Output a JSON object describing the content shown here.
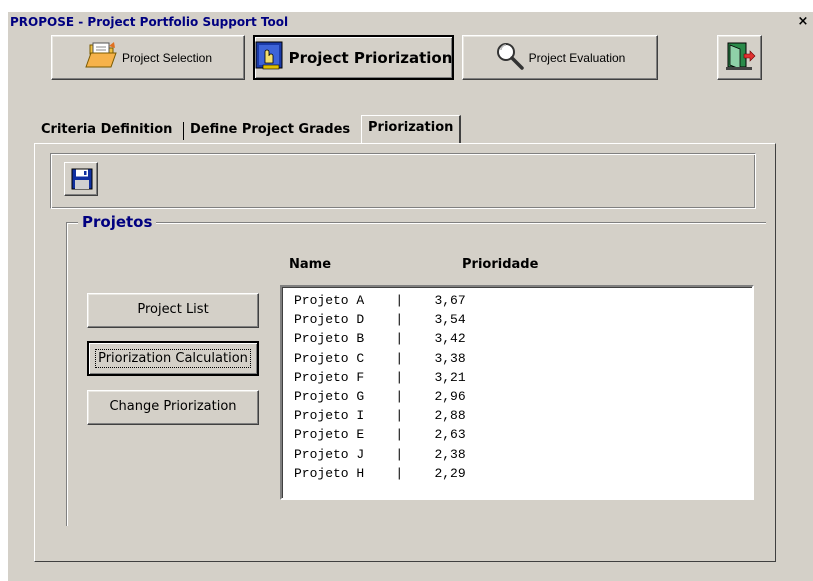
{
  "window": {
    "title": "PROPOSE - Project Portfolio Support Tool",
    "close_glyph": "×"
  },
  "toolbar": {
    "buttons": [
      {
        "label": "Project Selection",
        "icon": "folder-open-icon"
      },
      {
        "label": "Project Priorization",
        "icon": "hand-pointer-icon",
        "active": true
      },
      {
        "label": "Project Evaluation",
        "icon": "magnifier-icon"
      },
      {
        "label": "",
        "icon": "exit-door-icon"
      }
    ]
  },
  "tabs": [
    {
      "label": "Criteria Definition"
    },
    {
      "label": "Define Project Grades"
    },
    {
      "label": "Priorization",
      "active": true
    }
  ],
  "save_icon": "floppy-disk-icon",
  "group": {
    "legend": "Projetos",
    "columns": [
      "Name",
      "Prioridade"
    ],
    "buttons": [
      "Project List",
      "Priorization Calculation",
      "Change Priorization"
    ],
    "separator": "|",
    "rows": [
      {
        "name": "Projeto A",
        "priority": "3,67"
      },
      {
        "name": "Projeto D",
        "priority": "3,54"
      },
      {
        "name": "Projeto B",
        "priority": "3,42"
      },
      {
        "name": "Projeto C",
        "priority": "3,38"
      },
      {
        "name": "Projeto F",
        "priority": "3,21"
      },
      {
        "name": "Projeto G",
        "priority": "2,96"
      },
      {
        "name": "Projeto I",
        "priority": "2,88"
      },
      {
        "name": "Projeto E",
        "priority": "2,63"
      },
      {
        "name": "Projeto J",
        "priority": "2,38"
      },
      {
        "name": "Projeto H",
        "priority": "2,29"
      }
    ]
  },
  "colors": {
    "face": "#d4d0c8",
    "title": "#000080",
    "legend": "#000080"
  }
}
